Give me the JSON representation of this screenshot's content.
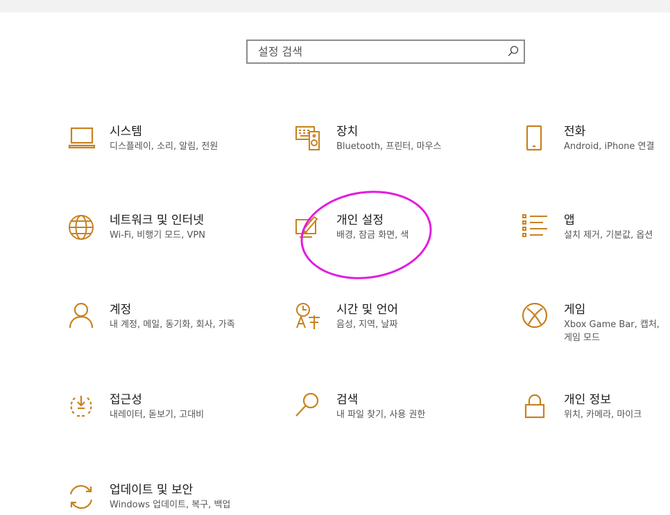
{
  "search": {
    "placeholder": "설정 검색",
    "value": ""
  },
  "colors": {
    "accent": "#c8811e",
    "annotation": "#e21be0"
  },
  "tiles": [
    {
      "icon": "laptop-icon",
      "title": "시스템",
      "desc": "디스플레이, 소리, 알림, 전원"
    },
    {
      "icon": "keyboard-speaker-icon",
      "title": "장치",
      "desc": "Bluetooth, 프린터, 마우스"
    },
    {
      "icon": "phone-icon",
      "title": "전화",
      "desc": "Android, iPhone 연결"
    },
    {
      "icon": "globe-icon",
      "title": "네트워크 및 인터넷",
      "desc": "Wi-Fi, 비행기 모드, VPN"
    },
    {
      "icon": "personalization-icon",
      "title": "개인 설정",
      "desc": "배경, 잠금 화면, 색"
    },
    {
      "icon": "apps-list-icon",
      "title": "앱",
      "desc": "설치 제거, 기본값, 옵션"
    },
    {
      "icon": "person-icon",
      "title": "계정",
      "desc": "내 계정, 메일, 동기화, 회사, 가족"
    },
    {
      "icon": "time-language-icon",
      "title": "시간 및 언어",
      "desc": "음성, 지역, 날짜"
    },
    {
      "icon": "xbox-icon",
      "title": "게임",
      "desc": "Xbox Game Bar, 캡처, 게임 모드"
    },
    {
      "icon": "accessibility-icon",
      "title": "접근성",
      "desc": "내레이터, 돋보기, 고대비"
    },
    {
      "icon": "search-icon",
      "title": "검색",
      "desc": "내 파일 찾기, 사용 권한"
    },
    {
      "icon": "lock-icon",
      "title": "개인 정보",
      "desc": "위치, 카메라, 마이크"
    },
    {
      "icon": "update-sync-icon",
      "title": "업데이트 및 보안",
      "desc": "Windows 업데이트, 복구, 백업"
    }
  ]
}
